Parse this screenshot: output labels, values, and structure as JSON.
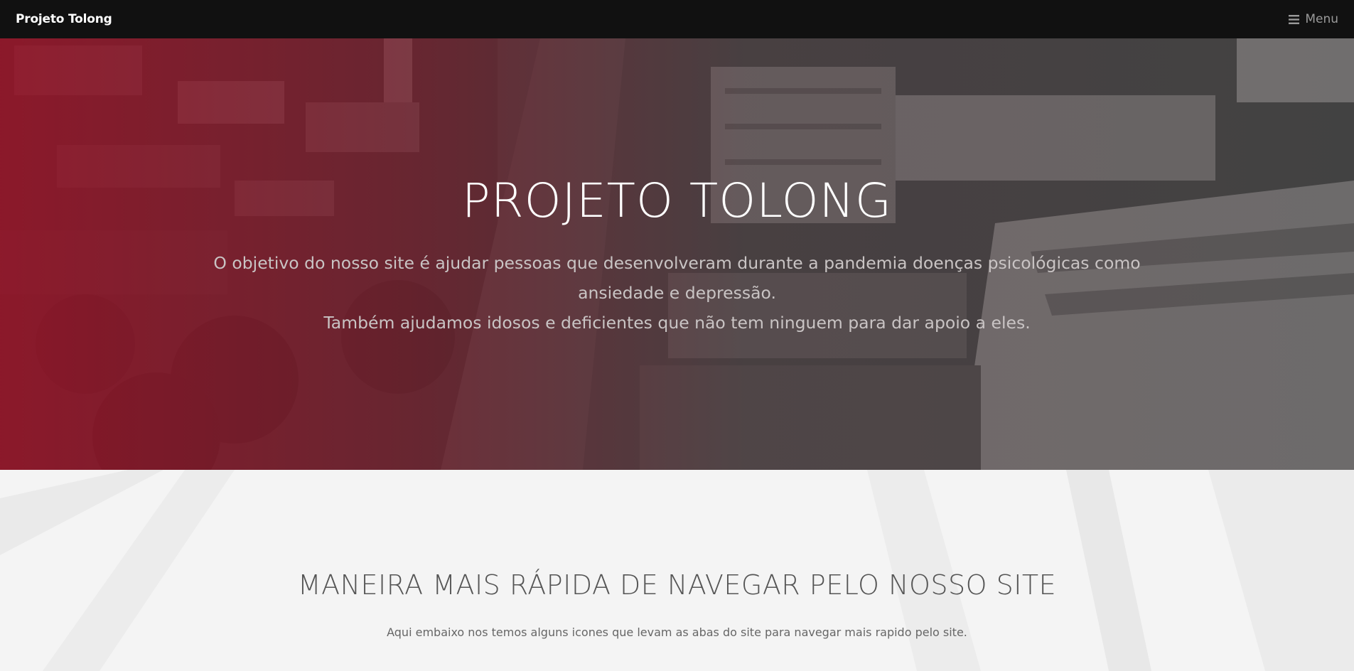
{
  "navbar": {
    "brand": "Projeto Tolong",
    "menu_label": "Menu",
    "menu_icon": "bars-icon"
  },
  "hero": {
    "title": "PROJETO TOLONG",
    "line1": "O objetivo do nosso site é ajudar pessoas que desenvolveram durante a pandemia doenças psicológicas como ansiedade e depressão.",
    "line2": "Também ajudamos idosos e deficientes que não tem ninguem para dar apoio a eles."
  },
  "quick_nav": {
    "title": "MANEIRA MAIS RÁPIDA DE NAVEGAR PELO NOSSO SITE",
    "subtitle": "Aqui embaixo nos temos alguns icones que levam as abas do site para navegar mais rapido pelo site."
  },
  "colors": {
    "navbar_bg": "#111111",
    "hero_gradient_start": "#96142a",
    "hero_gradient_end": "#3c3c3c",
    "section_bg": "#f4f4f4"
  }
}
